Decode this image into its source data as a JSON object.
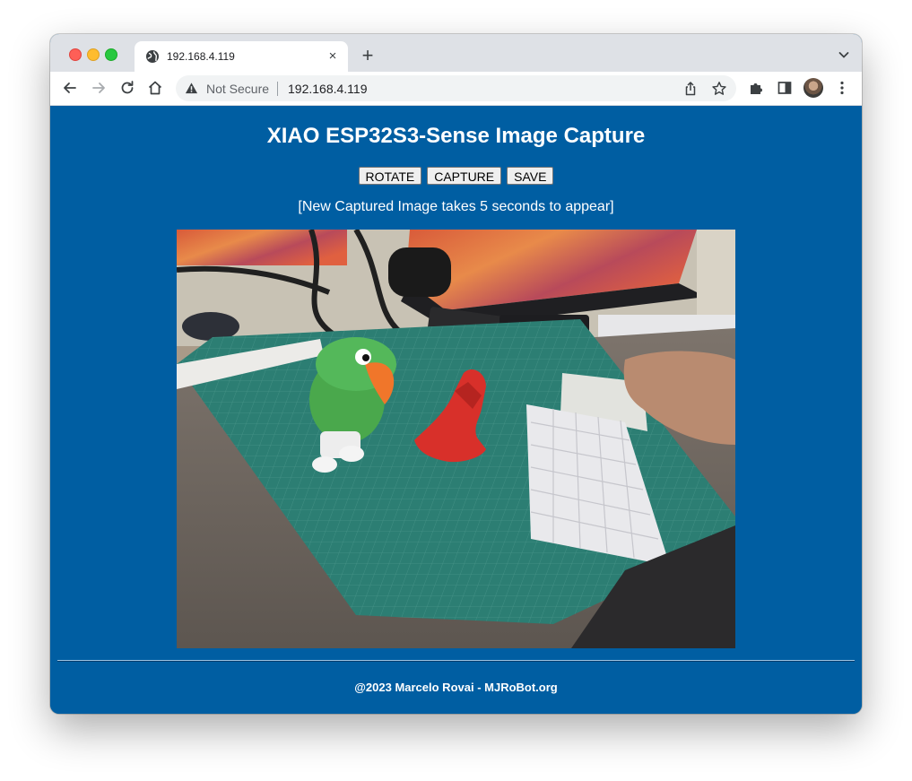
{
  "browser": {
    "tab_title": "192.168.4.119",
    "tab_close": "×",
    "new_tab": "+",
    "security_label": "Not Secure",
    "url": "192.168.4.119"
  },
  "page": {
    "title": "XIAO ESP32S3-Sense Image Capture",
    "buttons": {
      "rotate": "ROTATE",
      "capture": "CAPTURE",
      "save": "SAVE"
    },
    "note": "[New Captured Image takes 5 seconds to appear]",
    "footer": "@2023 Marcelo Rovai - MJRoBot.org"
  },
  "colors": {
    "page_background": "#005ea2",
    "tab_bar": "#dee1e6",
    "omnibox": "#f1f3f4"
  },
  "icons": [
    "globe-icon",
    "close-icon",
    "plus-icon",
    "chevron-down-icon",
    "back-arrow-icon",
    "forward-arrow-icon",
    "reload-icon",
    "home-icon",
    "warning-icon",
    "share-icon",
    "bookmark-star-icon",
    "extensions-icon",
    "side-panel-icon",
    "profile-avatar",
    "more-vert-icon"
  ]
}
